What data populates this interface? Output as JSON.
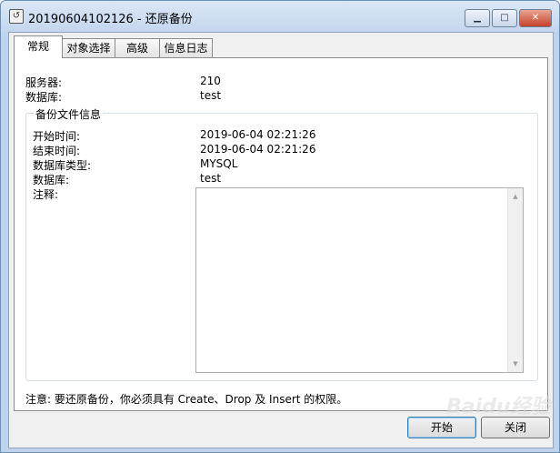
{
  "window": {
    "title": "20190604102126 - 还原备份",
    "minimize_glyph": "▁",
    "maximize_glyph": "□",
    "close_glyph": "✕"
  },
  "tabs": [
    "常规",
    "对象选择",
    "高级",
    "信息日志"
  ],
  "general": {
    "server_label": "服务器:",
    "server_value": "210",
    "database_label": "数据库:",
    "database_value": "test"
  },
  "backup_info": {
    "group_title": "备份文件信息",
    "start_time_label": "开始时间:",
    "start_time_value": "2019-06-04 02:21:26",
    "end_time_label": "结束时间:",
    "end_time_value": "2019-06-04 02:21:26",
    "db_type_label": "数据库类型:",
    "db_type_value": "MYSQL",
    "database_label": "数据库:",
    "database_value": "test",
    "comment_label": "注释:",
    "comment_value": ""
  },
  "note": "注意: 要还原备份，你必须具有 Create、Drop 及 Insert 的权限。",
  "buttons": {
    "start": "开始",
    "close": "关闭"
  },
  "watermark_text": "Baidu经验"
}
